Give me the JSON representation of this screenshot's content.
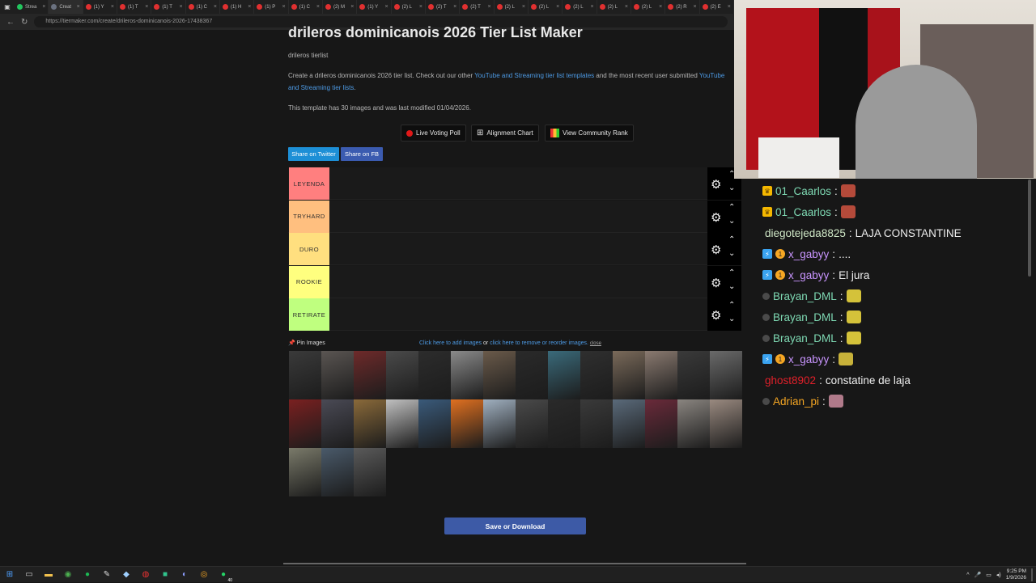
{
  "browser": {
    "tabs": [
      {
        "label": "Strea",
        "color": "#22c55e"
      },
      {
        "label": "Creat",
        "color": "#6b7280"
      },
      {
        "label": "(1) Y",
        "color": "#e03030"
      },
      {
        "label": "(1) T",
        "color": "#e03030"
      },
      {
        "label": "(1) T",
        "color": "#e03030"
      },
      {
        "label": "(1) C",
        "color": "#e03030"
      },
      {
        "label": "(1) H",
        "color": "#e03030"
      },
      {
        "label": "(1) P",
        "color": "#e03030"
      },
      {
        "label": "(1) C",
        "color": "#e03030"
      },
      {
        "label": "(2) M",
        "color": "#e03030"
      },
      {
        "label": "(1) Y",
        "color": "#e03030"
      },
      {
        "label": "(2) L",
        "color": "#e03030"
      },
      {
        "label": "(2) T",
        "color": "#e03030"
      },
      {
        "label": "(2) T",
        "color": "#e03030"
      },
      {
        "label": "(2) L",
        "color": "#e03030"
      },
      {
        "label": "(2) L",
        "color": "#e03030"
      },
      {
        "label": "(2) L",
        "color": "#e03030"
      },
      {
        "label": "(2) L",
        "color": "#e03030"
      },
      {
        "label": "(2) L",
        "color": "#e03030"
      },
      {
        "label": "(2) R",
        "color": "#e03030"
      },
      {
        "label": "(2) E",
        "color": "#e03030"
      }
    ],
    "url": "https://tiermaker.com/create/drileros-dominicanois-2026-17438367"
  },
  "page": {
    "title": "drileros dominicanois 2026 Tier List Maker",
    "subtitle": "drileros tierlist",
    "desc_1": "Create a drileros dominicanois 2026 tier list. Check out our other",
    "desc_link_1": "YouTube and Streaming tier list templates",
    "desc_2": "and the most recent user submitted",
    "desc_link_2a": "YouTube",
    "desc_link_2b": "and Streaming tier lists",
    "desc_end": ".",
    "template_info": "This template has 30 images and was last modified 01/04/2026.",
    "buttons": {
      "voting": "Live Voting Poll",
      "alignment": "Alignment Chart",
      "community": "View Community Rank",
      "twitter": "Share on Twitter",
      "facebook": "Share on FB",
      "save": "Save or Download"
    },
    "tiers": [
      {
        "label": "LEYENDA",
        "color": "#ff7f7f"
      },
      {
        "label": "TRYHARD",
        "color": "#ffbf7f"
      },
      {
        "label": "DURO",
        "color": "#ffdf7f"
      },
      {
        "label": "ROOKIE",
        "color": "#ffff7f"
      },
      {
        "label": "RETIRATE",
        "color": "#bfff7f"
      }
    ],
    "pin_images": "Pin Images",
    "add_images_link": "Click here to add images",
    "or_text": "or",
    "reorder_link": "click here to remove or reorder images.",
    "close_link": "close",
    "thumb_colors": [
      "#3a3a3a",
      "#5a5552",
      "#6e2a2a",
      "#4a4a4a",
      "#2c2c2c",
      "#8a8a8a",
      "#6a5a4a",
      "#2a2a2a",
      "#3a6a7a",
      "#2f2f2f",
      "#7a6a5a",
      "#8a7a70",
      "#3a3a3a",
      "#6a6a6a",
      "#7a2020",
      "#4a4a55",
      "#8a6a3a",
      "#c0c0c0",
      "#3a5a7a",
      "#e07020",
      "#a0b0c0",
      "#4a4a4a",
      "#2a2a2a",
      "#3a3a3a",
      "#5a6a7a",
      "#6a2a3a",
      "#8a8580",
      "#9a8a80",
      "#7a7a6a",
      "#4a5a6a",
      "#5a5a5a"
    ]
  },
  "chat": [
    {
      "badges": [
        "crown"
      ],
      "user": "01_Caarlos",
      "color": "#7ed9b3",
      "sep": " :",
      "message": "",
      "emote": "#b54a3a"
    },
    {
      "badges": [
        "crown"
      ],
      "user": "01_Caarlos",
      "color": "#7ed9b3",
      "sep": " :",
      "message": "",
      "emote": "#b54a3a"
    },
    {
      "badges": [],
      "user": "diegotejeda8825",
      "color": "#cfe7c6",
      "sep": " :",
      "message": "LAJA CONSTANTINE",
      "emote": ""
    },
    {
      "badges": [
        "prime",
        "one"
      ],
      "user": "x_gabyy",
      "color": "#c995ff",
      "sep": " :",
      "message": "....",
      "emote": ""
    },
    {
      "badges": [
        "prime",
        "one"
      ],
      "user": "x_gabyy",
      "color": "#c995ff",
      "sep": " :",
      "message": "El jura",
      "emote": ""
    },
    {
      "badges": [
        "dot"
      ],
      "user": "Brayan_DML",
      "color": "#7ed9b3",
      "sep": " :",
      "message": "",
      "emote": "#d4c23a"
    },
    {
      "badges": [
        "dot"
      ],
      "user": "Brayan_DML",
      "color": "#7ed9b3",
      "sep": " :",
      "message": "",
      "emote": "#d4c23a"
    },
    {
      "badges": [
        "dot"
      ],
      "user": "Brayan_DML",
      "color": "#7ed9b3",
      "sep": " :",
      "message": "",
      "emote": "#d4c23a"
    },
    {
      "badges": [
        "prime",
        "one"
      ],
      "user": "x_gabyy",
      "color": "#c995ff",
      "sep": " :",
      "message": "",
      "emote": "#c8b23a"
    },
    {
      "badges": [],
      "user": "ghost8902",
      "color": "#e0202a",
      "sep": " :",
      "message": "constatine de laja",
      "emote": ""
    },
    {
      "badges": [
        "dot"
      ],
      "user": "Adrian_pi",
      "color": "#f5a623",
      "sep": " :",
      "message": "",
      "emote": "#b07a8a"
    }
  ],
  "taskbar": {
    "time": "9:25 PM",
    "date": "1/9/2026",
    "whatsapp_count": "40"
  }
}
